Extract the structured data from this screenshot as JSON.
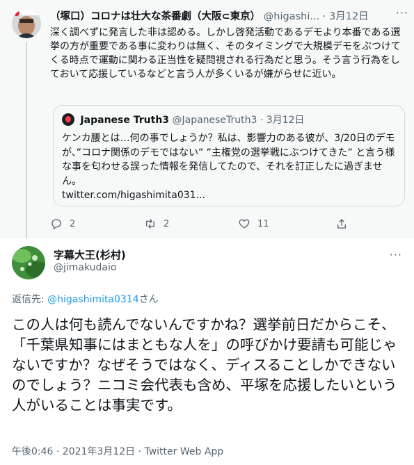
{
  "parent_tweet": {
    "display_name": "（塚口）コロナは壮大な茶番劇（大阪⊂東京）",
    "handle": "@higashi...",
    "separator": "·",
    "date": "3月12日",
    "more": "···",
    "text": "深く調べずに発言した非は認める。しかし啓発活動であるデモより本番である選挙の方が重要である事に変わりは無く、そのタイミングで大規模デモをぶつけてくる時点で運動に関わる正当性を疑問視される行為だと思う。そう言う行為をしておいて応援しているなどと言う人が多くいるが嫌がらせに近い。",
    "quote": {
      "display_name": "Japanese Truth3",
      "handle": "@JapaneseTruth3",
      "separator": "·",
      "date": "3月12日",
      "text": "ケンカ腰とは…何の事でしょうか？私は、影響力のある彼が、3/20日のデモが、”コロナ関係のデモではない” ”主権党の選挙戦にぶつけてきた” と言う様な事を匂わせる誤った情報を発信してたので、それを訂正したに過ぎません。",
      "link": "twitter.com/higashimita031..."
    },
    "actions": {
      "reply_count": "2",
      "retweet_count": "2",
      "like_count": "11"
    },
    "icons": [
      "reply-icon",
      "retweet-icon",
      "like-icon",
      "share-icon"
    ]
  },
  "main_tweet": {
    "display_name": "字幕大王(杉村)",
    "handle": "@jimakudaio",
    "more": "···",
    "reply_prefix": "返信先: ",
    "reply_mention": "@higashimita0314",
    "reply_suffix": "さん",
    "text": "この人は何も読んでないんですかね？選挙前日だからこそ、「千葉県知事にはまともな人を」の呼びかけ要請も可能じゃないですか？なぜそうではなく、ディスることしかできないのでしょう？ニコミ会代表も含め、平塚を応援したいという人がいることは事実です。",
    "meta": "午後0:46 · 2021年3月12日 · Twitter Web App"
  },
  "colors": {
    "accent": "#1d9bf0",
    "secondary_text": "#536471",
    "border": "#cfd9de",
    "hover_bg": "#f7f9f9"
  }
}
